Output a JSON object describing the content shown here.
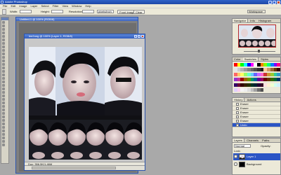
{
  "window": {
    "title": "Adobe Photoshop"
  },
  "menu": [
    "File",
    "Edit",
    "Image",
    "Layer",
    "Select",
    "Filter",
    "View",
    "Window",
    "Help"
  ],
  "options": {
    "width_label": "Width:",
    "height_label": "Height:",
    "resolution_label": "Resolution:",
    "units": "pixels/inch",
    "front_image": "Front Image",
    "clear": "Clear",
    "workspace": "Workspace"
  },
  "doc1": {
    "title": "Untitled-1 @ 100% (RGB/8)"
  },
  "doc2": {
    "title": "lee2ung @ 100% (Layer 1, RGB/8)",
    "status": "Doc: 356.5K/1.46M"
  },
  "navigator": {
    "tabs": [
      "Navigator",
      "Info",
      "Histogram"
    ]
  },
  "swatches": {
    "tabs": [
      "Color",
      "Swatches",
      "Styles"
    ],
    "colors": [
      "#ff0000",
      "#ffff00",
      "#00ff00",
      "#00ffff",
      "#0000ff",
      "#ff00ff",
      "#ffffff",
      "#000000",
      "#ff8000",
      "#80ff00",
      "#00ff80",
      "#0080ff",
      "#8000ff",
      "#ff0080",
      "#e6e6e6",
      "#cccccc",
      "#b3b3b3",
      "#999999",
      "#808080",
      "#666666",
      "#4d4d4d",
      "#333333",
      "#1a1a1a",
      "#ffcc99",
      "#cc9966",
      "#996633",
      "#663300",
      "#330000",
      "#ff6666",
      "#ffcc66",
      "#ffff66",
      "#99ff66",
      "#66ffcc",
      "#66ccff",
      "#6666ff",
      "#cc66ff",
      "#ff66cc",
      "#cc3333",
      "#cc9933",
      "#99cc33",
      "#33cc99",
      "#3399cc",
      "#9933cc",
      "#cc3399",
      "#990000",
      "#996600",
      "#669900",
      "#009966",
      "#006699",
      "#660099",
      "#990066",
      "#660000",
      "#663300",
      "#336600",
      "#006633",
      "#003366",
      "#330066",
      "#660033",
      "#330000",
      "#332200",
      "#223300",
      "#003322",
      "#002233",
      "#220033",
      "#330022",
      "#ffe0e0",
      "#fff0d0",
      "#f0ffd0",
      "#d0fff0",
      "#d0f0ff",
      "#e0d0ff",
      "#ffd0f0",
      "#f5f5f5",
      "#eeeeee",
      "#dddddd",
      "#c0c0c0",
      "#a0a0a0",
      "#707070",
      "#505050"
    ]
  },
  "history": {
    "tabs": [
      "History",
      "Actions"
    ],
    "rows": [
      "Eraser",
      "Eraser",
      "Eraser",
      "Eraser",
      "Eraser",
      "Undo"
    ]
  },
  "layers": {
    "tabs": [
      "Layers",
      "Channels",
      "Paths"
    ],
    "blend": "Normal",
    "opacity_label": "Opacity:",
    "lock_label": "Lock:",
    "items": [
      "Layer 1",
      "Background"
    ]
  }
}
